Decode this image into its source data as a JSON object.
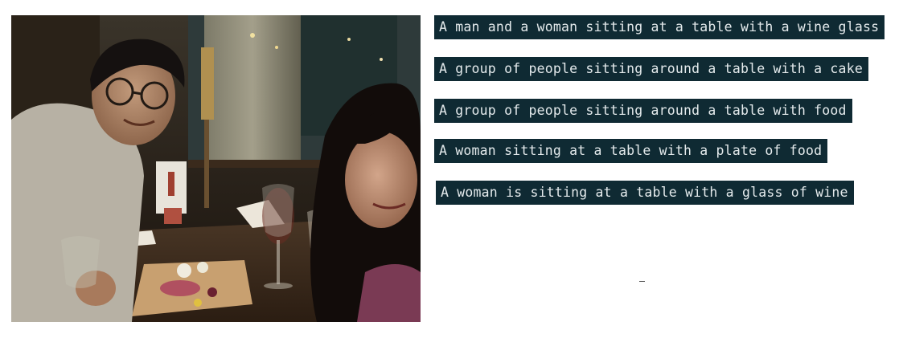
{
  "image": {
    "subject": "selfie-photo"
  },
  "captions": [
    "A man and a woman sitting at a table with a wine glass",
    "A group of people sitting around a table with a cake",
    "A group of people sitting around a table with food",
    "A woman sitting at a table with a plate of food",
    "A woman is sitting at a table with a glass of wine"
  ],
  "colors": {
    "caption_bg": "#0f2a33",
    "caption_text": "#e4eaec"
  }
}
